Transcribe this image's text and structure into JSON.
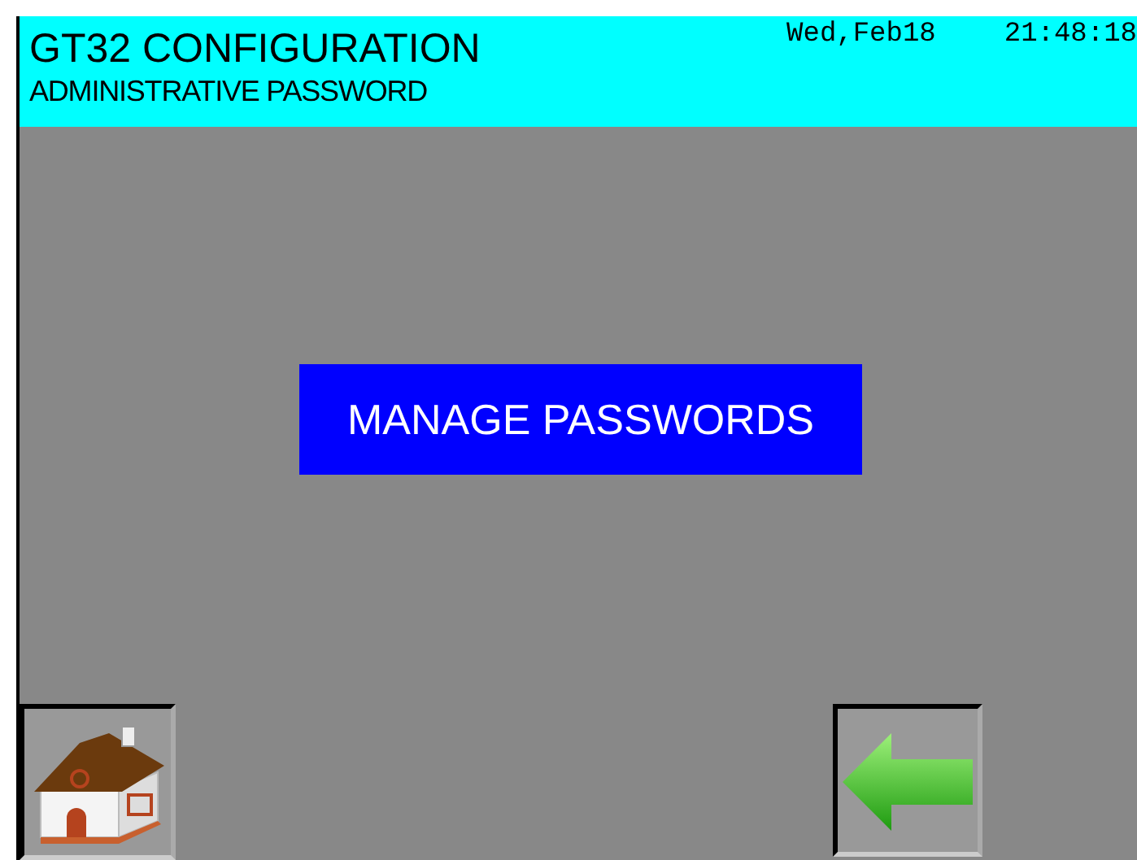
{
  "header": {
    "title": "GT32 CONFIGURATION",
    "subtitle": "ADMINISTRATIVE PASSWORD",
    "date": "Wed,Feb18",
    "time": "21:48:18"
  },
  "actions": [
    {
      "label": "MANAGE PASSWORDS"
    }
  ],
  "nav_buttons": [
    {
      "kind": "home"
    },
    {
      "kind": "back"
    }
  ]
}
